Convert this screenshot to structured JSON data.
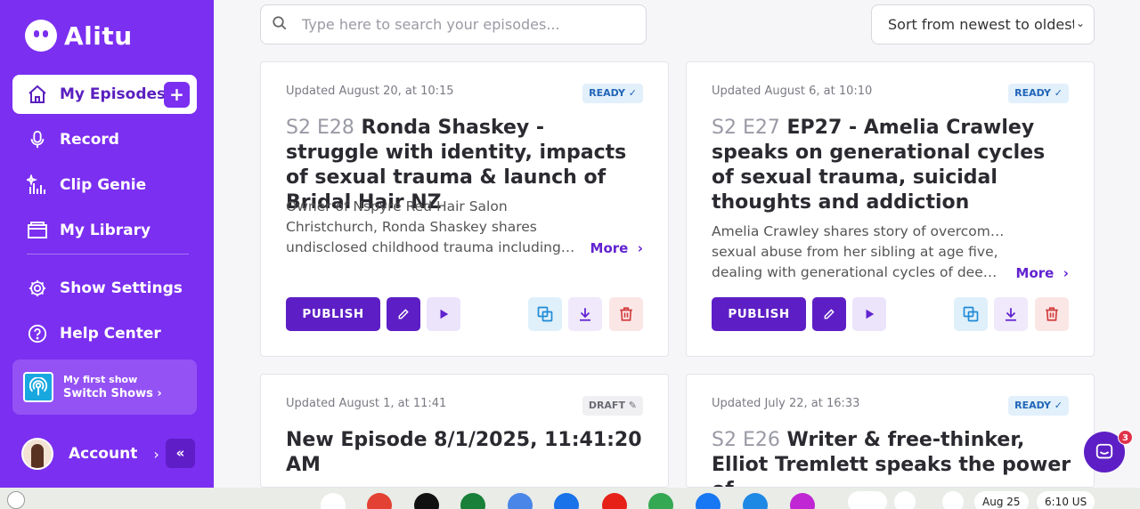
{
  "brand": {
    "name": "Alitu"
  },
  "sidebar": {
    "items": [
      {
        "label": "My Episodes",
        "icon": "home-icon",
        "active": true
      },
      {
        "label": "Record",
        "icon": "microphone-icon"
      },
      {
        "label": "Clip Genie",
        "icon": "sparkle-wave-icon"
      },
      {
        "label": "My Library",
        "icon": "folder-icon"
      },
      {
        "label": "Show Settings",
        "icon": "gear-icon"
      },
      {
        "label": "Help Center",
        "icon": "question-icon"
      }
    ],
    "add_label": "+",
    "show": {
      "name": "My first show",
      "action": "Switch Shows"
    },
    "account_label": "Account"
  },
  "search": {
    "placeholder": "Type here to search your episodes..."
  },
  "sort": {
    "value": "Sort from newest to oldest"
  },
  "episodes": [
    {
      "updated": "Updated August 20, at 10:15",
      "status": "READY ✓",
      "code": "S2 E28",
      "title": "Ronda Shaskey - struggle with identity, impacts of sexual trauma & launch of Bridal Hair NZ",
      "desc": [
        "Owner of Nspyre Red Hair Salon",
        "Christchurch, Ronda Shaskey shares",
        "undisclosed childhood trauma including…"
      ],
      "more": "More",
      "publish": "PUBLISH"
    },
    {
      "updated": "Updated August 6, at 10:10",
      "status": "READY ✓",
      "code": "S2 E27",
      "title": "EP27 - Amelia Crawley speaks on generational cycles of sexual trauma, suicidal thoughts and addiction",
      "desc": [
        "Amelia Crawley shares story of overcoming",
        "sexual abuse from her sibling at age five,",
        "dealing with generational cycles of deep…"
      ],
      "more": "More",
      "publish": "PUBLISH"
    },
    {
      "updated": "Updated August 1, at 11:41",
      "status": "DRAFT ✎",
      "code": "",
      "title": "New Episode 8/1/2025, 11:41:20 AM"
    },
    {
      "updated": "Updated July 22, at 16:33",
      "status": "READY ✓",
      "code": "S2 E26",
      "title": "Writer & free-thinker, Elliot Tremlett speaks the power of"
    }
  ],
  "chat": {
    "badge": "3"
  },
  "taskbar": {
    "date": "Aug 25",
    "time": "6:10",
    "locale": "US"
  },
  "colors": {
    "brand": "#7b2ff0",
    "primary": "#5d1fc5",
    "ready": "#2166b8",
    "danger": "#d23b3b"
  }
}
